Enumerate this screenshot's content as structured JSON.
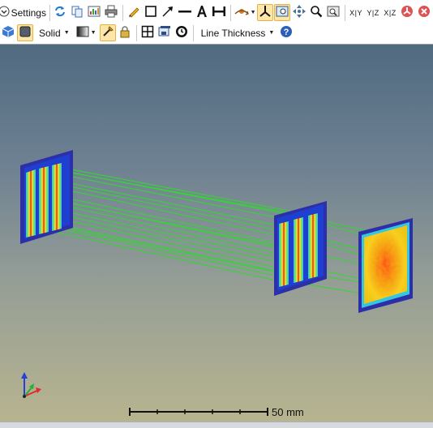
{
  "toolbar": {
    "settings_label": "Settings",
    "render_mode": "Solid",
    "line_thickness_label": "Line Thickness",
    "axis_labels": [
      "X|Y",
      "Y|Z",
      "X|Z"
    ]
  },
  "viewport": {
    "scale_bar_label": "50 mm"
  },
  "colors": {
    "toolbar_bg": "#ffffff",
    "active_tool_bg": "#fde6a8",
    "ray_color": "#35d535",
    "detector_frame": "#2d2fa8",
    "background_top": "#506a80",
    "background_bottom": "#b7b48f"
  },
  "icons": [
    "chevron-circle-icon",
    "refresh-icon",
    "copy-icon",
    "export-image-icon",
    "print-icon",
    "pencil-icon",
    "rectangle-icon",
    "arrow-icon",
    "line-icon",
    "text-icon",
    "dimension-icon",
    "rotate-icon",
    "axes-icon",
    "zoom-window-icon",
    "pan-icon",
    "zoom-icon",
    "zoom-fit-icon",
    "reset-icon",
    "close-circle-icon",
    "cube-icon",
    "shade-icon",
    "gradient-icon",
    "light-icon",
    "lock-icon",
    "grid-icon",
    "save-view-icon",
    "clock-icon",
    "help-icon"
  ]
}
